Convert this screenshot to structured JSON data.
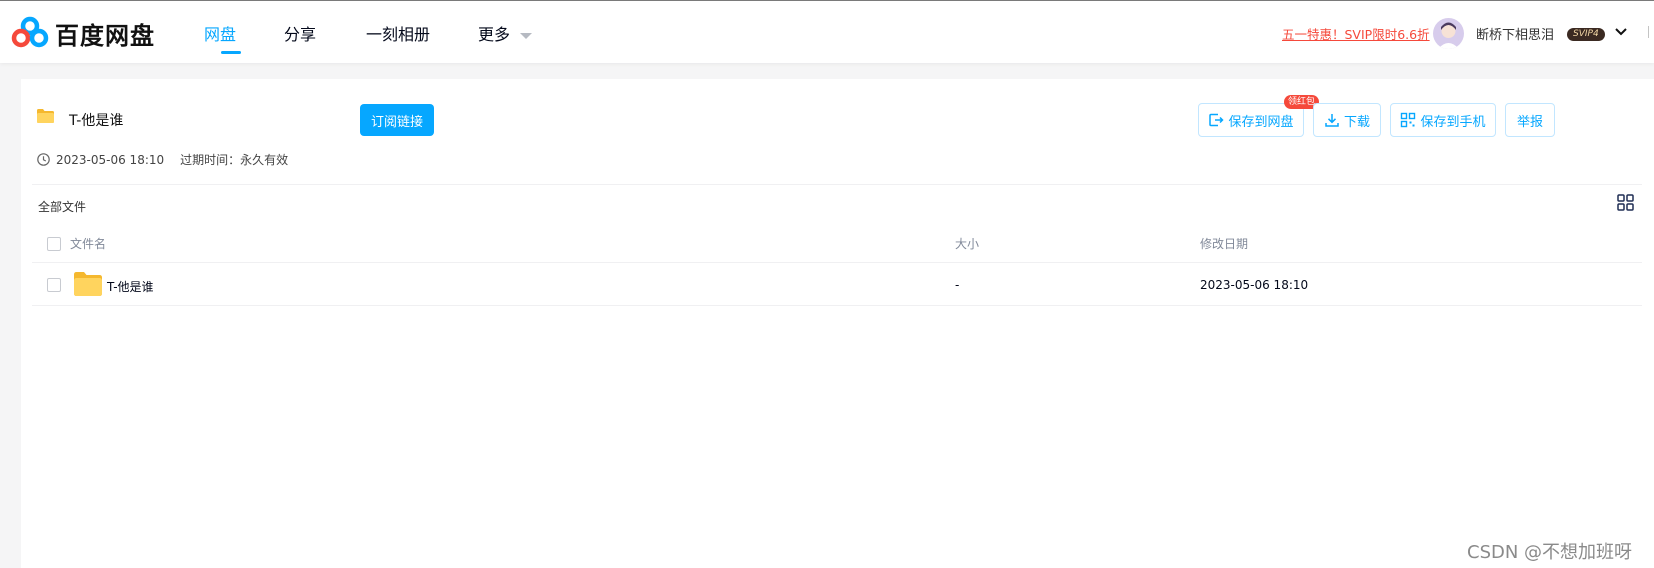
{
  "header": {
    "logo_text": "百度网盘",
    "nav": [
      {
        "label": "网盘",
        "active": true
      },
      {
        "label": "分享",
        "active": false
      },
      {
        "label": "一刻相册",
        "active": false
      },
      {
        "label": "更多",
        "active": false
      }
    ],
    "promo": "五一特惠！SVIP限时6.6折",
    "username": "断桥下相思泪",
    "vip_badge": "SVIP4"
  },
  "share": {
    "title": "T-他是谁",
    "subscribe_label": "订阅链接",
    "created": "2023-05-06 18:10",
    "expire": "过期时间：永久有效"
  },
  "actions": {
    "badge": "领红包",
    "save_to_disk": "保存到网盘",
    "download": "下载",
    "save_to_phone": "保存到手机",
    "report": "举报"
  },
  "list": {
    "breadcrumb": "全部文件",
    "columns": [
      "文件名",
      "大小",
      "修改日期"
    ],
    "rows": [
      {
        "name": "T-他是谁",
        "size": "-",
        "modified": "2023-05-06 18:10"
      }
    ]
  },
  "watermark": "CSDN @不想加班呀",
  "colors": {
    "accent": "#06a7ff",
    "promo": "#f5493b",
    "folder": "#ffd45e"
  }
}
